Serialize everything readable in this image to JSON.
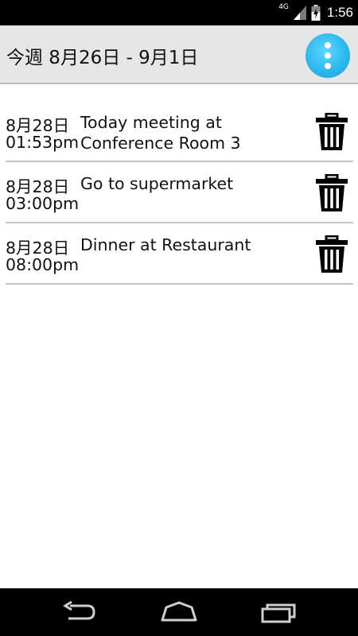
{
  "statusbar": {
    "network": "4G",
    "time": "1:56"
  },
  "actionbar": {
    "title": "今週 8月26日 - 9月1日",
    "overflow_icon": "more-vert-icon",
    "accent": "#2ab6ec"
  },
  "events": [
    {
      "date": "8月28日",
      "time": "01:53pm",
      "title": "Today meeting at\nConference Room 3"
    },
    {
      "date": "8月28日",
      "time": "03:00pm",
      "title": "Go to supermarket"
    },
    {
      "date": "8月28日",
      "time": "08:00pm",
      "title": "Dinner at Restaurant"
    }
  ],
  "navbar": {
    "buttons": [
      "back-icon",
      "home-icon",
      "recent-apps-icon"
    ]
  }
}
